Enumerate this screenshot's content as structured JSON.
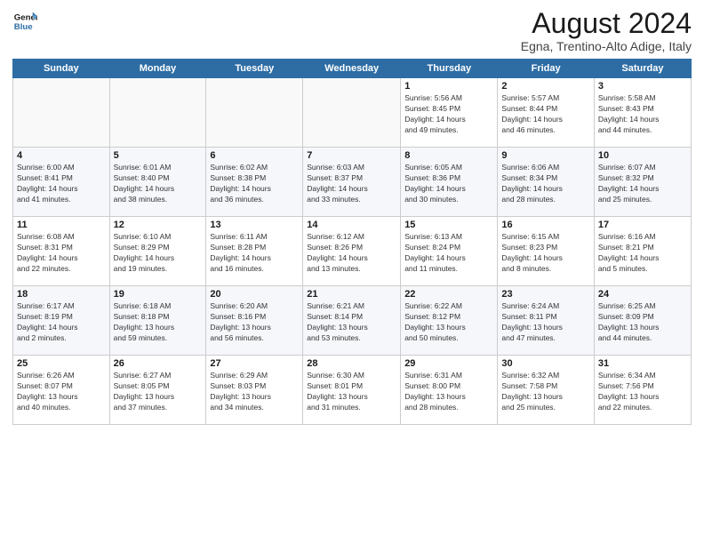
{
  "header": {
    "logo_line1": "General",
    "logo_line2": "Blue",
    "month_year": "August 2024",
    "location": "Egna, Trentino-Alto Adige, Italy"
  },
  "days_of_week": [
    "Sunday",
    "Monday",
    "Tuesday",
    "Wednesday",
    "Thursday",
    "Friday",
    "Saturday"
  ],
  "weeks": [
    [
      {
        "day": "",
        "info": ""
      },
      {
        "day": "",
        "info": ""
      },
      {
        "day": "",
        "info": ""
      },
      {
        "day": "",
        "info": ""
      },
      {
        "day": "1",
        "info": "Sunrise: 5:56 AM\nSunset: 8:45 PM\nDaylight: 14 hours\nand 49 minutes."
      },
      {
        "day": "2",
        "info": "Sunrise: 5:57 AM\nSunset: 8:44 PM\nDaylight: 14 hours\nand 46 minutes."
      },
      {
        "day": "3",
        "info": "Sunrise: 5:58 AM\nSunset: 8:43 PM\nDaylight: 14 hours\nand 44 minutes."
      }
    ],
    [
      {
        "day": "4",
        "info": "Sunrise: 6:00 AM\nSunset: 8:41 PM\nDaylight: 14 hours\nand 41 minutes."
      },
      {
        "day": "5",
        "info": "Sunrise: 6:01 AM\nSunset: 8:40 PM\nDaylight: 14 hours\nand 38 minutes."
      },
      {
        "day": "6",
        "info": "Sunrise: 6:02 AM\nSunset: 8:38 PM\nDaylight: 14 hours\nand 36 minutes."
      },
      {
        "day": "7",
        "info": "Sunrise: 6:03 AM\nSunset: 8:37 PM\nDaylight: 14 hours\nand 33 minutes."
      },
      {
        "day": "8",
        "info": "Sunrise: 6:05 AM\nSunset: 8:36 PM\nDaylight: 14 hours\nand 30 minutes."
      },
      {
        "day": "9",
        "info": "Sunrise: 6:06 AM\nSunset: 8:34 PM\nDaylight: 14 hours\nand 28 minutes."
      },
      {
        "day": "10",
        "info": "Sunrise: 6:07 AM\nSunset: 8:32 PM\nDaylight: 14 hours\nand 25 minutes."
      }
    ],
    [
      {
        "day": "11",
        "info": "Sunrise: 6:08 AM\nSunset: 8:31 PM\nDaylight: 14 hours\nand 22 minutes."
      },
      {
        "day": "12",
        "info": "Sunrise: 6:10 AM\nSunset: 8:29 PM\nDaylight: 14 hours\nand 19 minutes."
      },
      {
        "day": "13",
        "info": "Sunrise: 6:11 AM\nSunset: 8:28 PM\nDaylight: 14 hours\nand 16 minutes."
      },
      {
        "day": "14",
        "info": "Sunrise: 6:12 AM\nSunset: 8:26 PM\nDaylight: 14 hours\nand 13 minutes."
      },
      {
        "day": "15",
        "info": "Sunrise: 6:13 AM\nSunset: 8:24 PM\nDaylight: 14 hours\nand 11 minutes."
      },
      {
        "day": "16",
        "info": "Sunrise: 6:15 AM\nSunset: 8:23 PM\nDaylight: 14 hours\nand 8 minutes."
      },
      {
        "day": "17",
        "info": "Sunrise: 6:16 AM\nSunset: 8:21 PM\nDaylight: 14 hours\nand 5 minutes."
      }
    ],
    [
      {
        "day": "18",
        "info": "Sunrise: 6:17 AM\nSunset: 8:19 PM\nDaylight: 14 hours\nand 2 minutes."
      },
      {
        "day": "19",
        "info": "Sunrise: 6:18 AM\nSunset: 8:18 PM\nDaylight: 13 hours\nand 59 minutes."
      },
      {
        "day": "20",
        "info": "Sunrise: 6:20 AM\nSunset: 8:16 PM\nDaylight: 13 hours\nand 56 minutes."
      },
      {
        "day": "21",
        "info": "Sunrise: 6:21 AM\nSunset: 8:14 PM\nDaylight: 13 hours\nand 53 minutes."
      },
      {
        "day": "22",
        "info": "Sunrise: 6:22 AM\nSunset: 8:12 PM\nDaylight: 13 hours\nand 50 minutes."
      },
      {
        "day": "23",
        "info": "Sunrise: 6:24 AM\nSunset: 8:11 PM\nDaylight: 13 hours\nand 47 minutes."
      },
      {
        "day": "24",
        "info": "Sunrise: 6:25 AM\nSunset: 8:09 PM\nDaylight: 13 hours\nand 44 minutes."
      }
    ],
    [
      {
        "day": "25",
        "info": "Sunrise: 6:26 AM\nSunset: 8:07 PM\nDaylight: 13 hours\nand 40 minutes."
      },
      {
        "day": "26",
        "info": "Sunrise: 6:27 AM\nSunset: 8:05 PM\nDaylight: 13 hours\nand 37 minutes."
      },
      {
        "day": "27",
        "info": "Sunrise: 6:29 AM\nSunset: 8:03 PM\nDaylight: 13 hours\nand 34 minutes."
      },
      {
        "day": "28",
        "info": "Sunrise: 6:30 AM\nSunset: 8:01 PM\nDaylight: 13 hours\nand 31 minutes."
      },
      {
        "day": "29",
        "info": "Sunrise: 6:31 AM\nSunset: 8:00 PM\nDaylight: 13 hours\nand 28 minutes."
      },
      {
        "day": "30",
        "info": "Sunrise: 6:32 AM\nSunset: 7:58 PM\nDaylight: 13 hours\nand 25 minutes."
      },
      {
        "day": "31",
        "info": "Sunrise: 6:34 AM\nSunset: 7:56 PM\nDaylight: 13 hours\nand 22 minutes."
      }
    ]
  ]
}
